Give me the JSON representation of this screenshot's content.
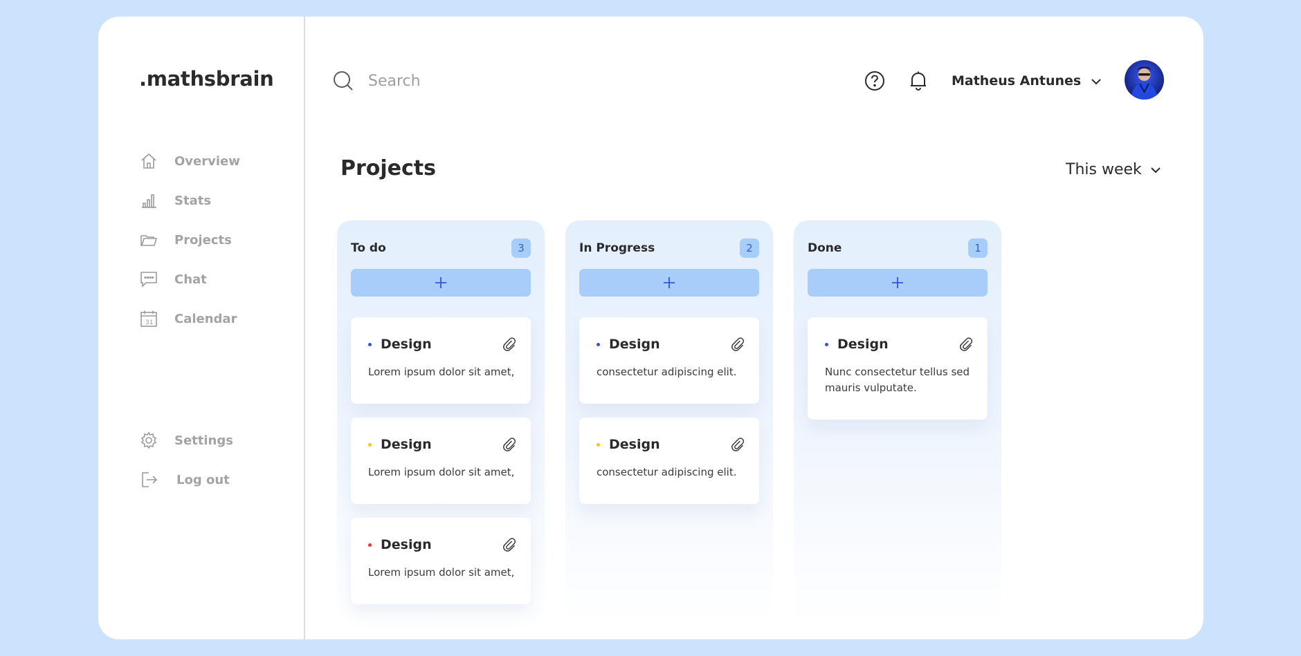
{
  "brand": ".mathsbrain",
  "nav": {
    "overview": "Overview",
    "stats": "Stats",
    "projects": "Projects",
    "chat": "Chat",
    "calendar": "Calendar",
    "settings": "Settings",
    "logout": "Log out"
  },
  "search": {
    "placeholder": "Search"
  },
  "user": {
    "name": "Matheus Antunes"
  },
  "page": {
    "title": "Projects",
    "period": "This week"
  },
  "columns": [
    {
      "title": "To do",
      "count": "3",
      "cards": [
        {
          "title": "Design",
          "text": "Lorem ipsum dolor sit amet,",
          "dot_color": "#3b4fe0"
        },
        {
          "title": "Design",
          "text": "Lorem ipsum dolor sit amet,",
          "dot_color": "#f5c518"
        },
        {
          "title": "Design",
          "text": "Lorem ipsum dolor sit amet,",
          "dot_color": "#e53935"
        }
      ]
    },
    {
      "title": "In Progress",
      "count": "2",
      "cards": [
        {
          "title": "Design",
          "text": "consectetur adipiscing elit.",
          "dot_color": "#3b4fe0"
        },
        {
          "title": "Design",
          "text": "consectetur adipiscing elit.",
          "dot_color": "#f5c518"
        }
      ]
    },
    {
      "title": "Done",
      "count": "1",
      "cards": [
        {
          "title": "Design",
          "text": "Nunc consectetur tellus sed mauris vulputate.",
          "dot_color": "#3b4fe0"
        }
      ]
    }
  ],
  "colors": {
    "background": "#cce2fd",
    "accent": "#a8cdfa",
    "count_text": "#3461c7",
    "plus": "#2e56d9"
  }
}
